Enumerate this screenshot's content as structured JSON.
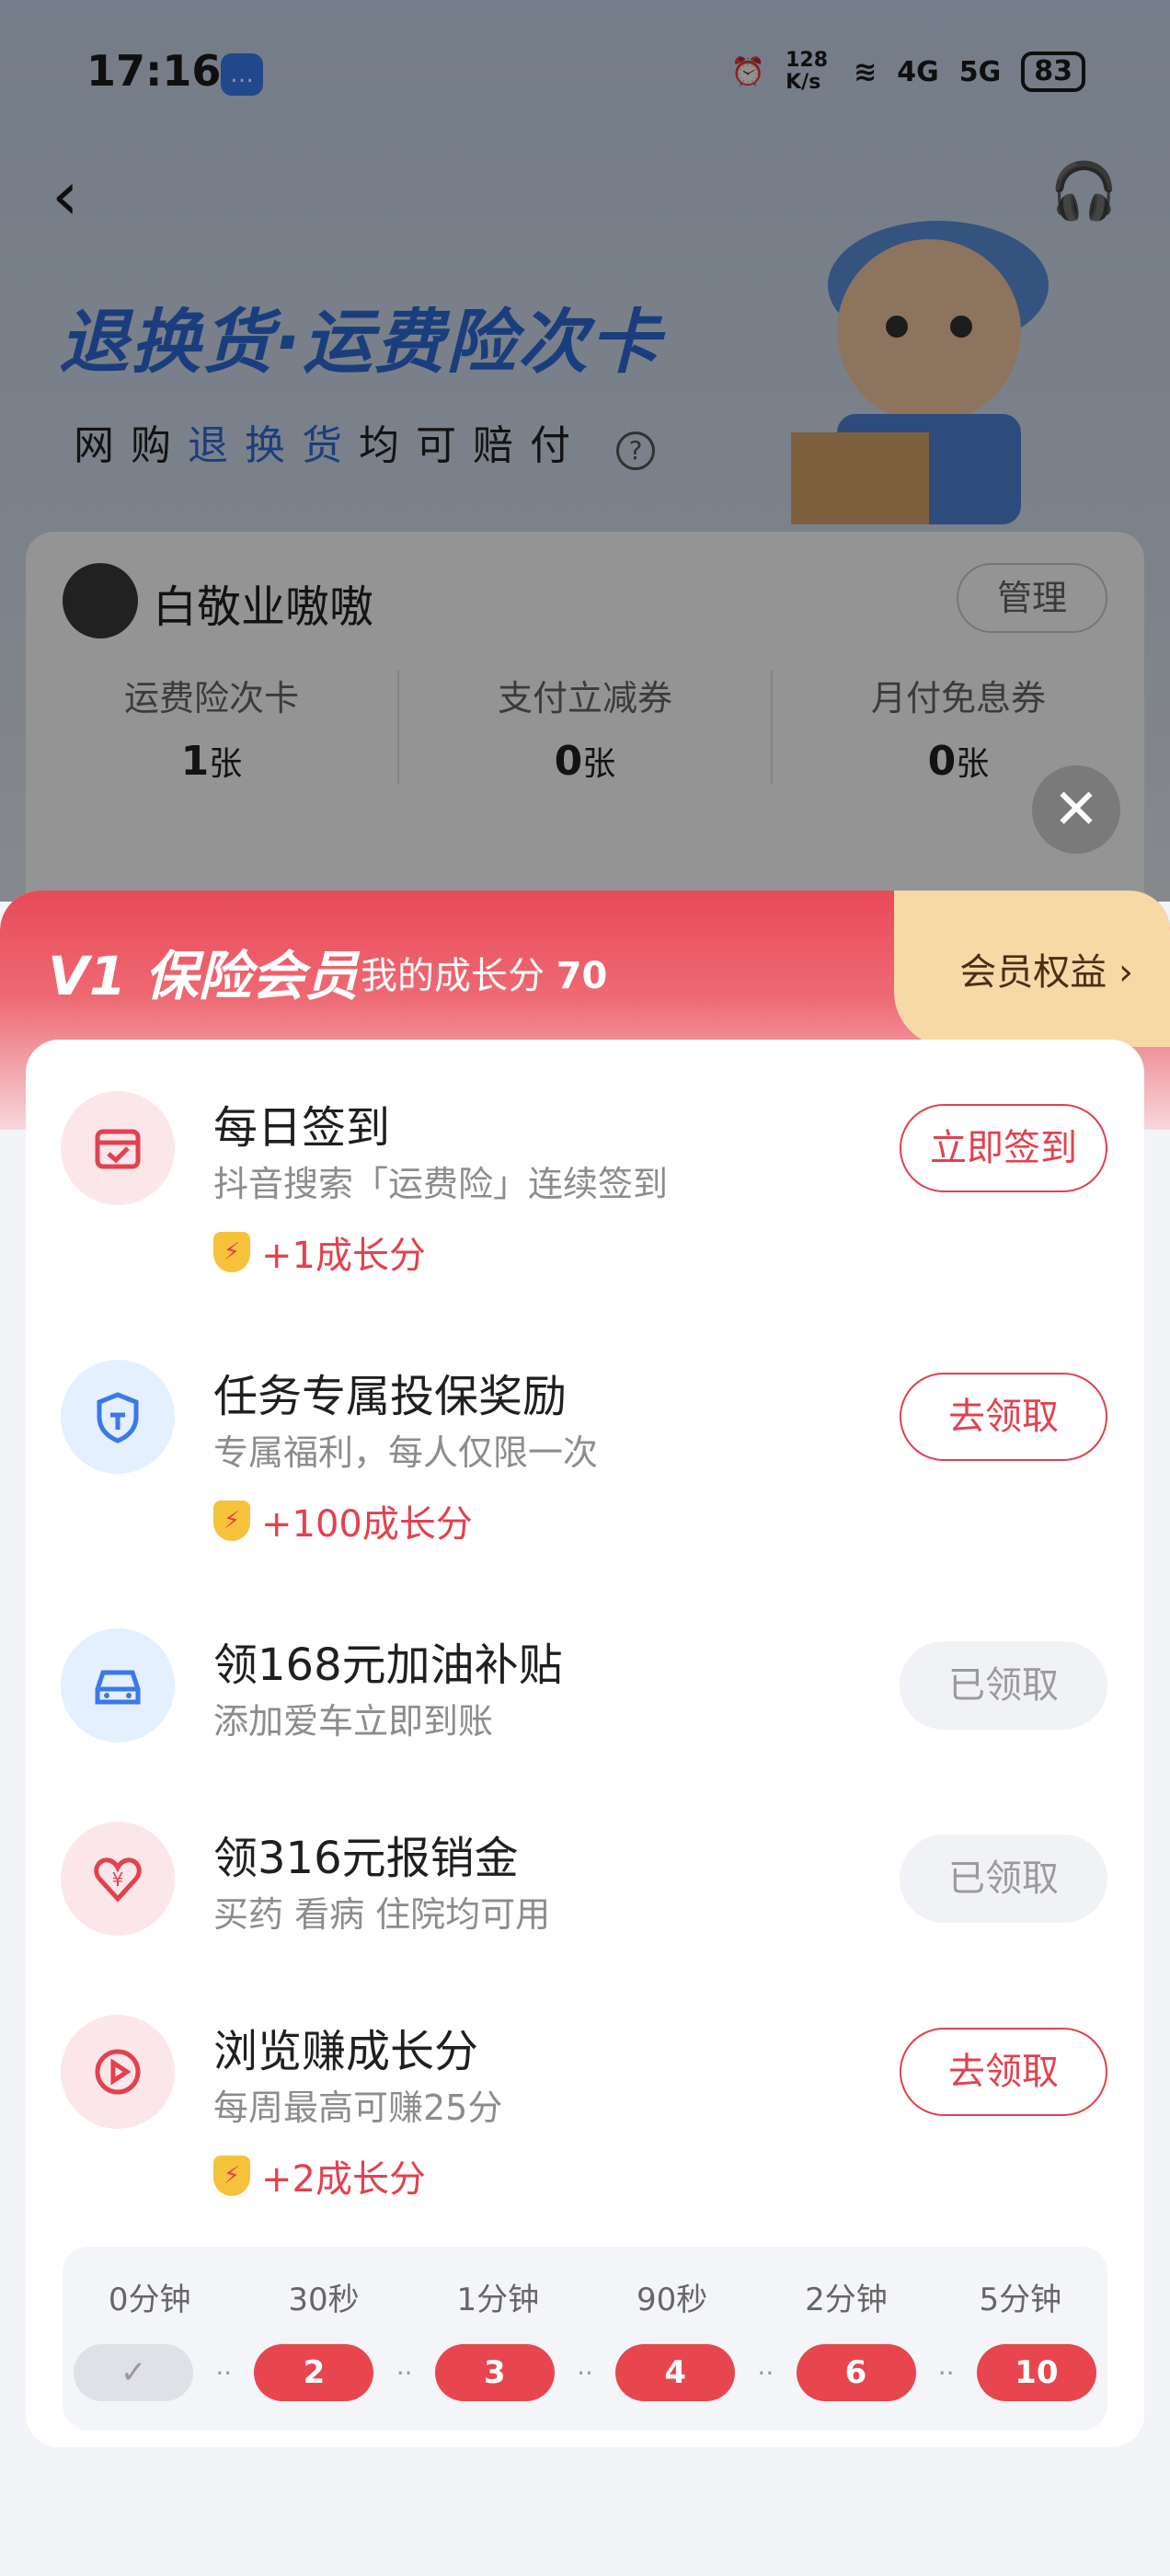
{
  "status_bar": {
    "time": "17:16",
    "speed": "128 K/s",
    "net1": "4G",
    "net2": "5G",
    "battery": "83"
  },
  "header": {
    "title": "退换货·运费险次卡",
    "subtitle_pre": "网购",
    "subtitle_hl": "退换货",
    "subtitle_post": "均可赔付",
    "help": "?"
  },
  "user_card": {
    "name": "白敬业嗷嗷",
    "manage_label": "管理",
    "stats": [
      {
        "label": "运费险次卡",
        "value": "1",
        "unit": "张"
      },
      {
        "label": "支付立减券",
        "value": "0",
        "unit": "张"
      },
      {
        "label": "月付免息券",
        "value": "0",
        "unit": "张"
      }
    ]
  },
  "sheet": {
    "title": "V1 保险会员",
    "growth_label": "我的成长分",
    "growth_value": "70",
    "benefit_label": "会员权益 ›",
    "tasks": [
      {
        "title": "每日签到",
        "desc": "抖音搜索「运费险」连续签到",
        "reward": "+1成长分",
        "button": "立即签到",
        "icon": "calendar-check-icon"
      },
      {
        "title": "任务专属投保奖励",
        "desc": "专属福利，每人仅限一次",
        "reward": "+100成长分",
        "button": "去领取",
        "icon": "shield-icon"
      },
      {
        "title": "领168元加油补贴",
        "desc": "添加爱车立即到账",
        "button": "已领取",
        "icon": "car-icon"
      },
      {
        "title": "领316元报销金",
        "desc": "买药 看病 住院均可用",
        "button": "已领取",
        "icon": "heart-yen-icon"
      },
      {
        "title": "浏览赚成长分",
        "desc": "每周最高可赚25分",
        "reward": "+2成长分",
        "button": "去领取",
        "icon": "play-icon"
      }
    ],
    "timeline": {
      "labels": [
        "0分钟",
        "30秒",
        "1分钟",
        "90秒",
        "2分钟",
        "5分钟"
      ],
      "values": [
        "✓",
        "2",
        "3",
        "4",
        "6",
        "10"
      ]
    }
  },
  "colors": {
    "accent": "#e4404e",
    "blue": "#2d6cd8"
  }
}
